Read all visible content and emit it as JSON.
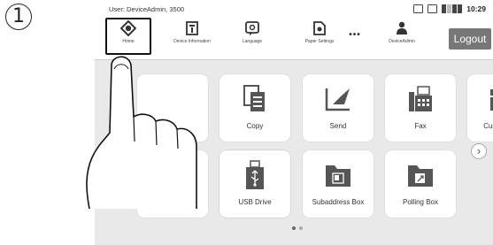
{
  "step_marker": "1",
  "header": {
    "user_text": "User: DeviceAdmin, 3500",
    "time": "10:29"
  },
  "toolbar": {
    "home_label": "Home",
    "device_info_label": "Device Information",
    "language_label": "Language",
    "paper_settings_label": "Paper Settings",
    "more_label": "•••",
    "device_admin_label": "DeviceAdmin",
    "logout_label": "Logout"
  },
  "tiles": {
    "copy": "Copy",
    "send": "Send",
    "fax": "Fax",
    "custom_box": "Custom Box",
    "usb_drive": "USB Drive",
    "subaddress_box": "Subaddress Box",
    "polling_box": "Polling Box"
  },
  "next_page_icon": "›",
  "colors": {
    "screen_bg": "#e9e9e9",
    "logout_bg": "#777777",
    "tile_bg": "#ffffff"
  }
}
